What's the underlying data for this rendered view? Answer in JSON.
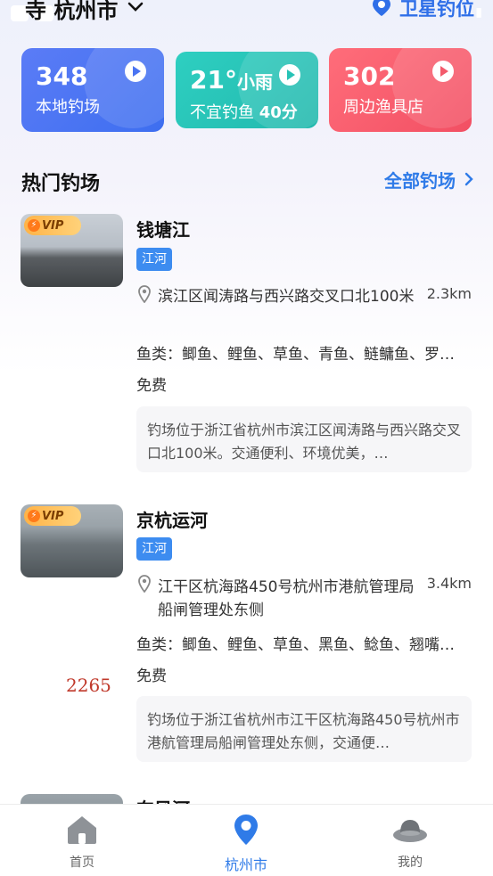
{
  "header": {
    "city_title": "寺 杭州市",
    "satellite_label": "卫星钓位"
  },
  "cards": [
    {
      "value": "348",
      "label": "本地钓场"
    },
    {
      "value": "21°",
      "weather": "小雨",
      "label": "不宜钓鱼",
      "score": "40分"
    },
    {
      "value": "302",
      "label": "周边渔具店"
    }
  ],
  "section": {
    "title": "热门钓场",
    "link": "全部钓场"
  },
  "badge_vip": "VIP",
  "spots": [
    {
      "name": "钱塘江",
      "tag": "江河",
      "address": "滨江区闻涛路与西兴路交叉口北100米",
      "distance": "2.3km",
      "fish": "鱼类：鲫鱼、鲤鱼、草鱼、青鱼、鲢鳙鱼、罗…",
      "price": "免费",
      "desc": "钓场位于浙江省杭州市滨江区闻涛路与西兴路交叉口北100米。交通便利、环境优美，…"
    },
    {
      "name": "京杭运河",
      "tag": "江河",
      "address": "江干区杭海路450号杭州市港航管理局船闸管理处东侧",
      "distance": "3.4km",
      "fish": "鱼类：鲫鱼、鲤鱼、草鱼、黑鱼、鲶鱼、翘嘴…",
      "price": "免费",
      "desc": "钓场位于浙江省杭州市江干区杭海路450号杭州市港航管理局船闸管理处东侧，交通便…"
    },
    {
      "name": "东风河"
    }
  ],
  "watermark": "2265",
  "tabs": [
    {
      "label": "首页"
    },
    {
      "label": "杭州市"
    },
    {
      "label": "我的"
    }
  ],
  "colors": {
    "accent": "#2f7be8",
    "card_blue": "#4a74f2",
    "card_teal": "#27c3b6",
    "card_red": "#f35b6c"
  }
}
